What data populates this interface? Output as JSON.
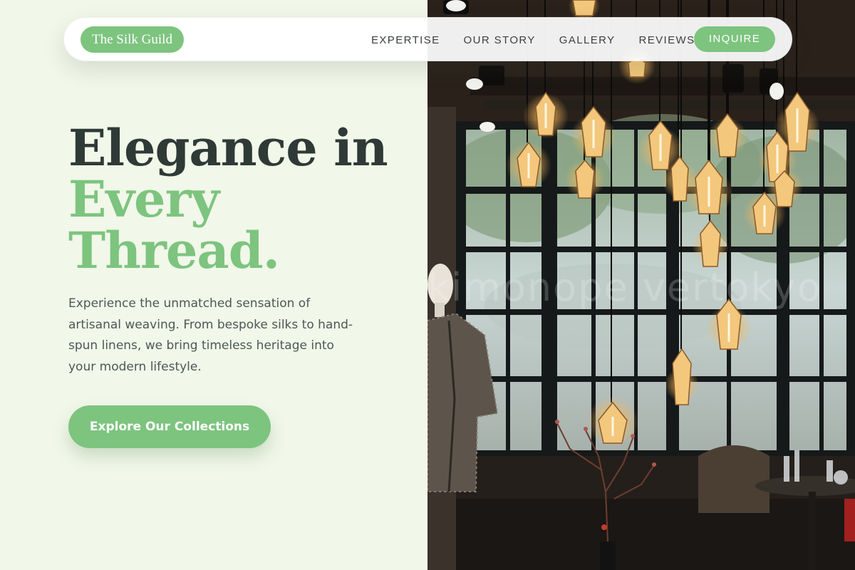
{
  "brand": {
    "name": "The Silk Guild"
  },
  "nav": {
    "links": [
      "EXPERTISE",
      "OUR STORY",
      "GALLERY",
      "REVIEWS"
    ],
    "cta": "INQUIRE"
  },
  "hero": {
    "headline_line1": "Elegance in",
    "headline_line2": "Every",
    "headline_line3": "Thread.",
    "lead": "Experience the unmatched sensation of artisanal weaving. From bespoke silks to hand-spun linens, we bring timeless heritage into your modern lifestyle.",
    "cta": "Explore Our Collections"
  },
  "photo": {
    "watermark": "kimonope  vertokyo"
  },
  "colors": {
    "accent": "#7dc47f",
    "background": "#f1f7e9",
    "heading": "#2f3a37",
    "body_text": "#4c5856"
  }
}
